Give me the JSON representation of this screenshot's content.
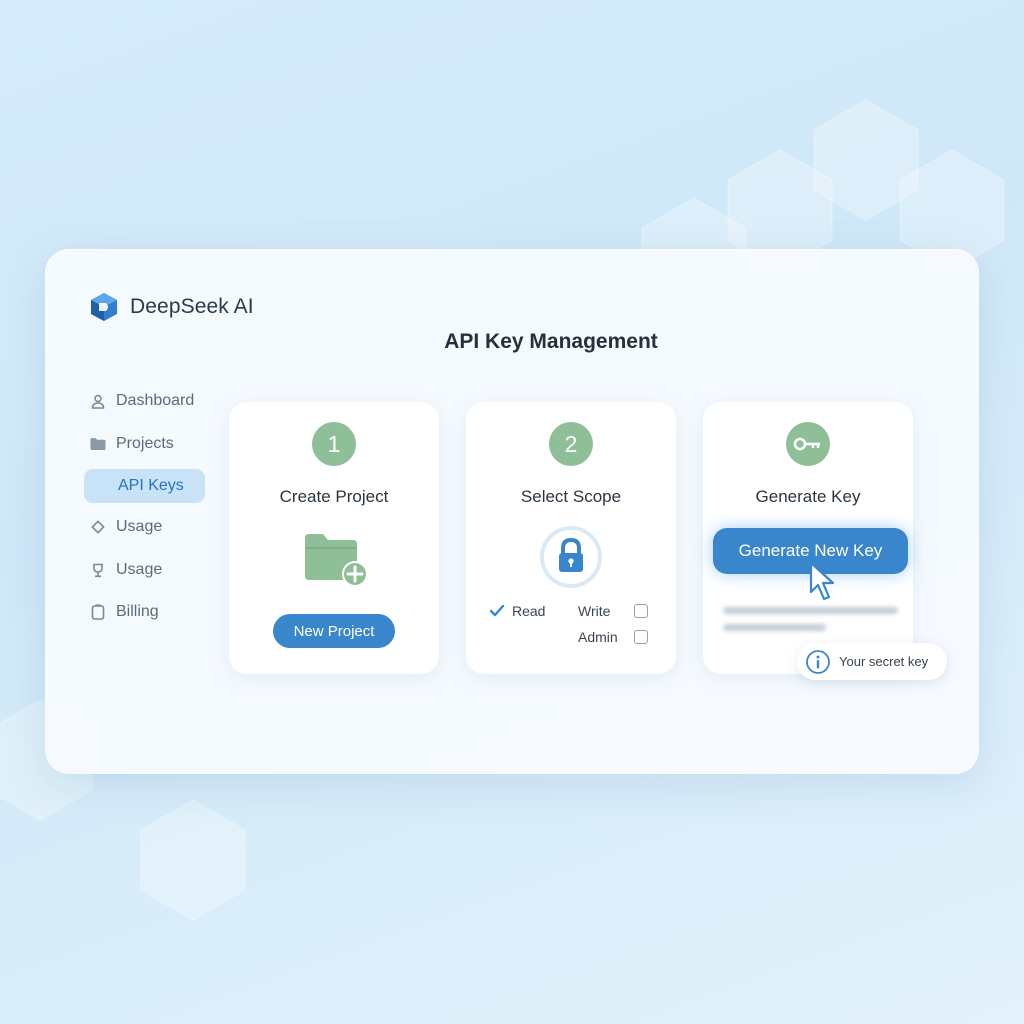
{
  "brand": {
    "name": "DeepSeek AI",
    "logo_icon": "deepseek-logo-icon"
  },
  "page": {
    "title": "API Key Management"
  },
  "sidebar": {
    "items": [
      {
        "label": "Dashboard",
        "icon": "user-icon",
        "active": false
      },
      {
        "label": "Projects",
        "icon": "folder-icon",
        "active": false
      },
      {
        "label": "API Keys",
        "icon": "",
        "active": true
      },
      {
        "label": "Usage",
        "icon": "diamond-icon",
        "active": false
      },
      {
        "label": "Usage",
        "icon": "trophy-icon",
        "active": false
      },
      {
        "label": "Billing",
        "icon": "clipboard-icon",
        "active": false
      }
    ]
  },
  "steps": [
    {
      "number": "1",
      "title": "Create Project",
      "icon": "folder-plus-icon",
      "button_label": "New Project"
    },
    {
      "number": "2",
      "title": "Select Scope",
      "icon": "lock-icon",
      "scopes": [
        {
          "label": "Read",
          "checked": true
        },
        {
          "label": "Write",
          "checked": false
        },
        {
          "label": "Admin",
          "checked": false
        }
      ]
    },
    {
      "title": "Generate Key",
      "icon": "key-icon",
      "button_label": "Generate New Key"
    }
  ],
  "tooltip": {
    "text": "Your secret key",
    "icon": "info-icon"
  },
  "colors": {
    "accent": "#3a86cc",
    "step_green": "#8fbf96",
    "active_nav_bg": "#c8e3f7"
  }
}
